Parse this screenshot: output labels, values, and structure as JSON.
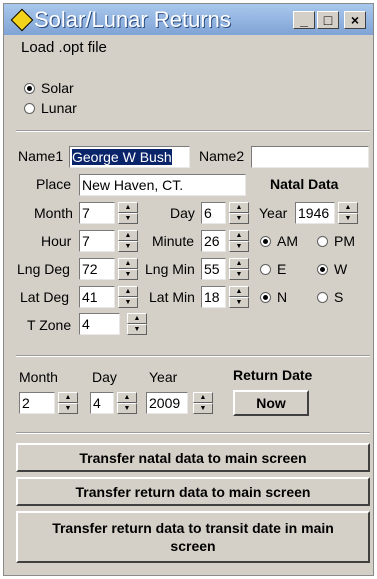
{
  "window": {
    "title": "Solar/Lunar Returns"
  },
  "titlebar_buttons": {
    "minimize": "_",
    "maximize": "□",
    "close": "×"
  },
  "menu": {
    "load": "Load .opt file"
  },
  "mode": {
    "solar": "Solar",
    "lunar": "Lunar",
    "selected": "Solar"
  },
  "names": {
    "name1_label": "Name1",
    "name1_value": "George W Bush",
    "name2_label": "Name2",
    "name2_value": ""
  },
  "natal": {
    "heading": "Natal Data",
    "place_label": "Place",
    "place_value": "New Haven, CT.",
    "month_label": "Month",
    "month_value": "7",
    "day_label": "Day",
    "day_value": "6",
    "year_label": "Year",
    "year_value": "1946",
    "hour_label": "Hour",
    "hour_value": "7",
    "minute_label": "Minute",
    "minute_value": "26",
    "lngdeg_label": "Lng Deg",
    "lngdeg_value": "72",
    "lngmin_label": "Lng Min",
    "lngmin_value": "55",
    "latdeg_label": "Lat Deg",
    "latdeg_value": "41",
    "latmin_label": "Lat Min",
    "latmin_value": "18",
    "tzone_label": "T Zone",
    "tzone_value": "4",
    "am": "AM",
    "pm": "PM",
    "ampm_selected": "AM",
    "east": "E",
    "west": "W",
    "ew_selected": "W",
    "north": "N",
    "south": "S",
    "ns_selected": "N"
  },
  "return": {
    "heading": "Return Date",
    "month_label": "Month",
    "month_value": "2",
    "day_label": "Day",
    "day_value": "4",
    "year_label": "Year",
    "year_value": "2009",
    "now_button": "Now"
  },
  "actions": {
    "transfer_natal": "Transfer natal data to main screen",
    "transfer_return": "Transfer return data to main screen",
    "transfer_transit": "Transfer return data to transit date in main screen"
  }
}
